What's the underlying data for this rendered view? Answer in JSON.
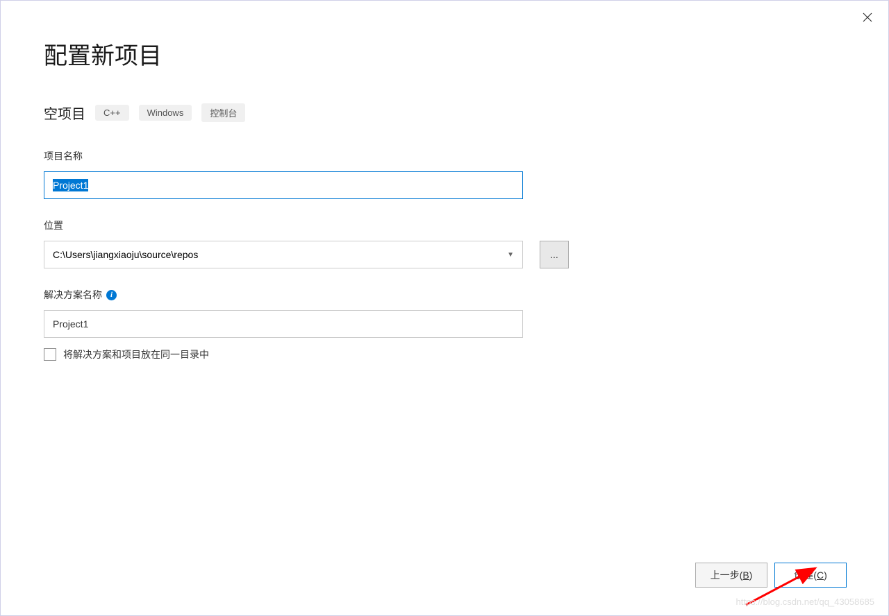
{
  "header": {
    "title": "配置新项目"
  },
  "subtitle": {
    "text": "空项目",
    "tags": [
      "C++",
      "Windows",
      "控制台"
    ]
  },
  "form": {
    "project_name": {
      "label": "项目名称",
      "value": "Project1"
    },
    "location": {
      "label": "位置",
      "value": "C:\\Users\\jiangxiaoju\\source\\repos",
      "browse": "..."
    },
    "solution_name": {
      "label": "解决方案名称",
      "value": "Project1"
    },
    "same_dir_checkbox": {
      "label": "将解决方案和项目放在同一目录中",
      "checked": false
    }
  },
  "footer": {
    "back_prefix": "上一步(",
    "back_key": "B",
    "back_suffix": ")",
    "create_prefix": "创建(",
    "create_key": "C",
    "create_suffix": ")"
  },
  "watermark": "https://blog.csdn.net/qq_43058685"
}
